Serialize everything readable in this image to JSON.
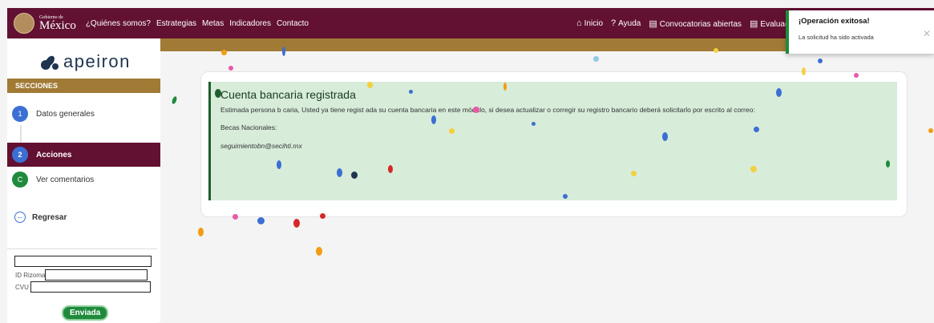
{
  "navbar": {
    "brand_small": "Gobierno de",
    "brand_name": "México",
    "links": [
      "¿Quiénes somos?",
      "Estrategias",
      "Metas",
      "Indicadores",
      "Contacto"
    ],
    "right_links": [
      "Inicio",
      "Ayuda",
      "Convocatorias abiertas",
      "Evaluac"
    ]
  },
  "sidebar": {
    "logo_text": "apeiron",
    "sections_title": "SECCIONES",
    "steps": [
      {
        "num": "1",
        "label": "Datos generales",
        "color": "#3b6fd4"
      },
      {
        "num": "2",
        "label": "Acciones",
        "color": "#3b6fd4"
      },
      {
        "num": "C",
        "label": "Ver comentarios",
        "color": "#1f8a3c"
      }
    ],
    "back_label": "Regresar",
    "form": {
      "id_label": "ID Rizoma",
      "cvu_label": "CVU",
      "status_badge": "Enviada"
    }
  },
  "alert": {
    "title": "Cuenta bancaria registrada",
    "message": "Estimada persona b caria, Usted ya tiene regist ada su cuenta bancaria en este módulo, si desea actualizar o corregir su registro bancario deberá solicitarlo por escrito al correo:",
    "program": "Becas Nacionales:",
    "email": "seguimientobn@secihti.mx"
  },
  "toast": {
    "title": "¡Operación exitosa!",
    "message": "La solicitud ha sido activada"
  },
  "colors": {
    "nav_bg": "#621132",
    "gold": "#a17a35",
    "alert_bg": "#d7ecd9",
    "success": "#1f8a3c"
  }
}
